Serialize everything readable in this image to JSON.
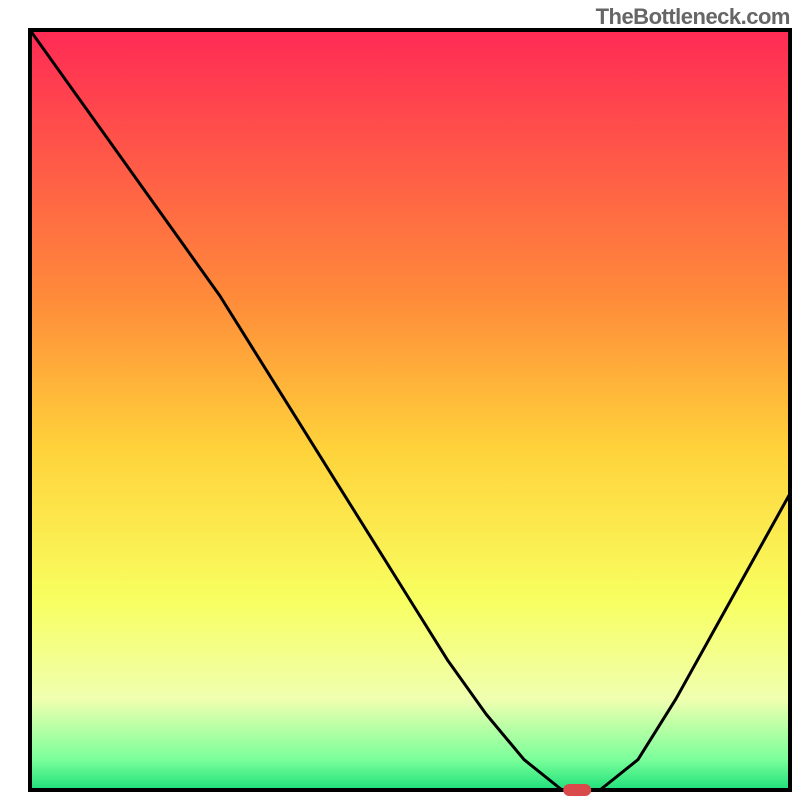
{
  "watermark": "TheBottleneck.com",
  "chart_data": {
    "type": "line",
    "title": "",
    "xlabel": "",
    "ylabel": "",
    "xlim": [
      0,
      100
    ],
    "ylim": [
      0,
      100
    ],
    "x": [
      0,
      5,
      10,
      15,
      20,
      25,
      30,
      35,
      40,
      45,
      50,
      55,
      60,
      65,
      70,
      75,
      80,
      85,
      90,
      95,
      100
    ],
    "values": [
      100,
      93,
      86,
      79,
      72,
      65,
      57,
      49,
      41,
      33,
      25,
      17,
      10,
      4,
      0,
      0,
      4,
      12,
      21,
      30,
      39
    ],
    "minimum_x": 72,
    "marker": {
      "x": 72,
      "y": 0
    },
    "gradient_stops": [
      {
        "offset": 0,
        "color": "#ff2a55"
      },
      {
        "offset": 35,
        "color": "#ff8a3a"
      },
      {
        "offset": 55,
        "color": "#ffd23a"
      },
      {
        "offset": 75,
        "color": "#f8ff60"
      },
      {
        "offset": 88,
        "color": "#f0ffb0"
      },
      {
        "offset": 96,
        "color": "#7aff9a"
      },
      {
        "offset": 100,
        "color": "#1ee07a"
      }
    ],
    "frame_color": "#000000",
    "line_color": "#000000",
    "marker_color": "#d94a4a"
  }
}
